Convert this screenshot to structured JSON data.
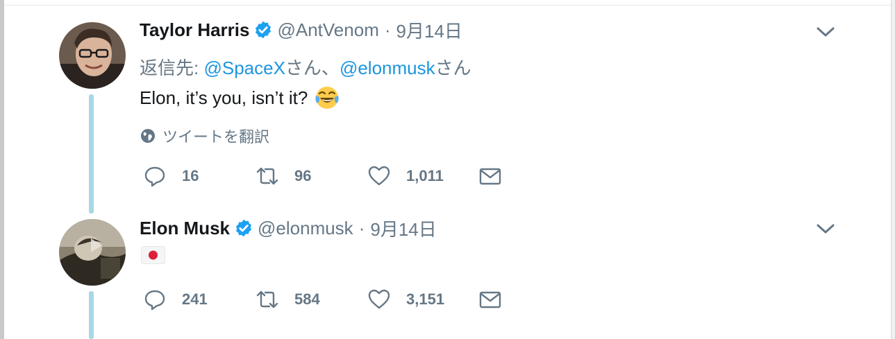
{
  "tweets": [
    {
      "name": "Taylor Harris",
      "handle": "@AntVenom",
      "date": "9月14日",
      "reply_to": {
        "prefix": "返信先: ",
        "user1": "@SpaceX",
        "suffix1": "さん、",
        "user2": "@elonmusk",
        "suffix2": "さん"
      },
      "text": "Elon, it’s you, isn’t it?",
      "emoji": "face-with-tears-of-joy",
      "translate_label": "ツイートを翻訳",
      "counts": {
        "replies": "16",
        "retweets": "96",
        "likes": "1,011"
      }
    },
    {
      "name": "Elon Musk",
      "handle": "@elonmusk",
      "date": "9月14日",
      "text_emoji": "japan-flag",
      "counts": {
        "replies": "241",
        "retweets": "584",
        "likes": "3,151"
      }
    }
  ],
  "colors": {
    "link": "#1b95e0",
    "verified": "#1da1f2",
    "secondary_text": "#657786",
    "thread_line": "#a8d7e6"
  }
}
